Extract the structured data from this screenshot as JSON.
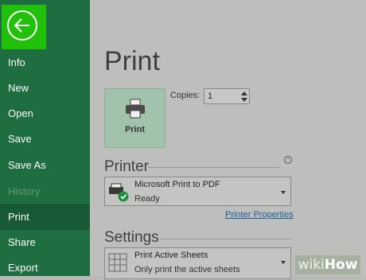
{
  "sidebar": {
    "items": [
      {
        "label": "Info"
      },
      {
        "label": "New"
      },
      {
        "label": "Open"
      },
      {
        "label": "Save"
      },
      {
        "label": "Save As"
      },
      {
        "label": "History"
      },
      {
        "label": "Print"
      },
      {
        "label": "Share"
      },
      {
        "label": "Export"
      }
    ]
  },
  "main": {
    "title": "Print",
    "print_button_label": "Print",
    "copies_label": "Copies:",
    "copies_value": "1",
    "printer_heading": "Printer",
    "printer_name": "Microsoft Print to PDF",
    "printer_status": "Ready",
    "printer_properties_link": "Printer Properties",
    "settings_heading": "Settings",
    "settings_option": "Print Active Sheets",
    "settings_option_sub": "Only print the active sheets"
  },
  "watermark": {
    "wiki": "wiki",
    "how": "How"
  },
  "colors": {
    "sidebar": "#1f6e41",
    "back_highlight": "#21c10b",
    "active_item": "#185a35",
    "link": "#1a5e9c"
  }
}
